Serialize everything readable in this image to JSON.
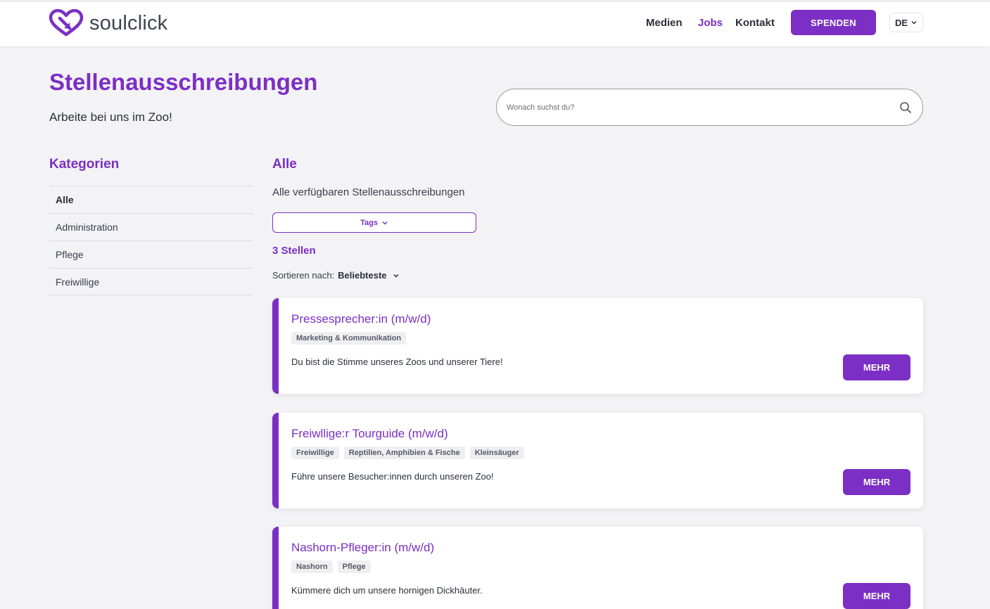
{
  "header": {
    "brand": "soulclick",
    "nav": [
      {
        "label": "Medien",
        "active": false
      },
      {
        "label": "Jobs",
        "active": true
      },
      {
        "label": "Kontakt",
        "active": false
      }
    ],
    "donate_label": "SPENDEN",
    "language": "DE"
  },
  "hero": {
    "title": "Stellenausschreibungen",
    "subtitle": "Arbeite bei uns im Zoo!",
    "search_placeholder": "Wonach suchst du?"
  },
  "sidebar": {
    "title": "Kategorien",
    "items": [
      {
        "label": "Alle",
        "active": true
      },
      {
        "label": "Administration",
        "active": false
      },
      {
        "label": "Pflege",
        "active": false
      },
      {
        "label": "Freiwillige",
        "active": false
      }
    ]
  },
  "main": {
    "title": "Alle",
    "description": "Alle verfügbaren Stellenausschreibungen",
    "tags_label": "Tags",
    "count_label": "3 Stellen",
    "sort_label": "Sortieren nach:",
    "sort_value": "Beliebteste"
  },
  "jobs": [
    {
      "title": "Pressesprecher:in (m/w/d)",
      "tags": [
        "Marketing & Kommunikation"
      ],
      "description": "Du bist die Stimme unseres Zoos und unserer Tiere!",
      "button": "MEHR"
    },
    {
      "title": "Freiwllige:r Tourguide (m/w/d)",
      "tags": [
        "Freiwillige",
        "Reptilien, Amphibien & Fische",
        "Kleinsäuger"
      ],
      "description": "Führe unsere Besucher:innen durch unseren Zoo!",
      "button": "MEHR"
    },
    {
      "title": "Nashorn-Pfleger:in (m/w/d)",
      "tags": [
        "Nashorn",
        "Pflege"
      ],
      "description": "Kümmere dich um unsere hornigen Dickhäuter.",
      "button": "MEHR"
    }
  ],
  "colors": {
    "accent": "#7b2fc4",
    "background": "#f3f2f5",
    "text": "#2b2f3a"
  }
}
